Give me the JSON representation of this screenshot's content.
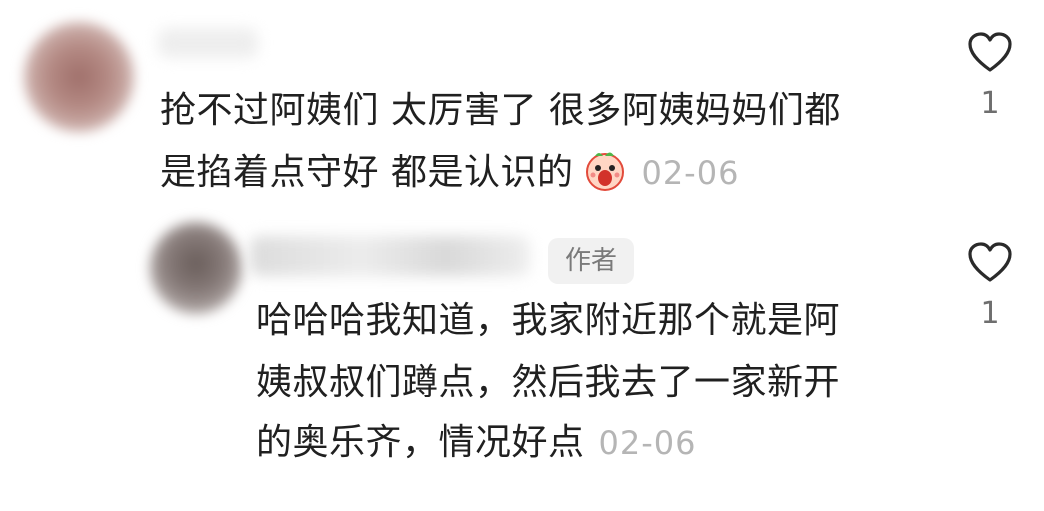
{
  "comments": [
    {
      "lines": [
        "抢不过阿姨们 太厉害了 很多阿姨妈妈们都",
        "是掐着点守好 都是认识的"
      ],
      "emoji": "screaming-face-emoji",
      "date": "02-06",
      "likes": "1"
    }
  ],
  "reply": {
    "badge": "作者",
    "lines": [
      "哈哈哈我知道，我家附近那个就是阿",
      "姨叔叔们蹲点，然后我去了一家新开",
      "的奥乐齐，情况好点"
    ],
    "date": "02-06",
    "likes": "1"
  }
}
